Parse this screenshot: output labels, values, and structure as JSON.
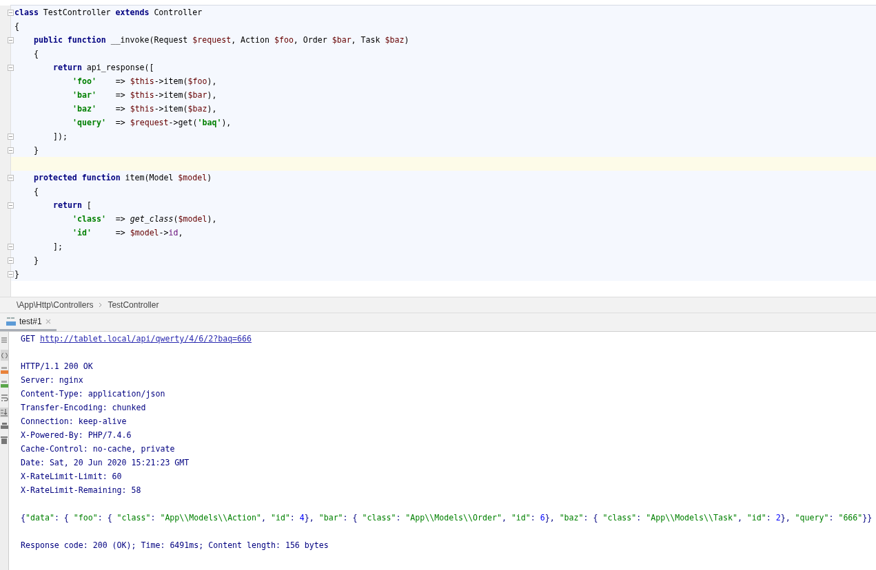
{
  "editor": {
    "lines": [
      {
        "fold": true,
        "current": false,
        "tokens": [
          {
            "t": "class",
            "kind": "kw"
          },
          {
            "t": "TestController",
            "kind": "plain"
          },
          {
            "t": "extends",
            "kind": "kw"
          },
          {
            "t": "Controller",
            "kind": "plain"
          }
        ]
      },
      {
        "fold": false,
        "current": false,
        "tokens": [
          {
            "t": "{",
            "kind": "plain"
          }
        ],
        "children": [
          {
            "fold": true,
            "current": false,
            "tokens": [
              {
                "t": "public function",
                "kind": "kw"
              },
              {
                "t": "__invoke(Request",
                "kind": "plain"
              },
              {
                "t": "$request",
                "kind": "var"
              },
              {
                "t": ", Action",
                "kind": "plain"
              },
              {
                "t": "$foo",
                "kind": "var"
              },
              {
                "t": ", Order",
                "kind": "plain"
              },
              {
                "t": "$bar",
                "kind": "var"
              },
              {
                "t": ", Task",
                "kind": "plain"
              },
              {
                "t": "$baz",
                "kind": "var"
              },
              {
                "t": ")",
                "kind": "plain"
              }
            ]
          },
          {
            "fold": false,
            "current": false,
            "tokens": [
              {
                "t": "{",
                "kind": "plain"
              }
            ],
            "children": [
              {
                "fold": true,
                "current": false,
                "tokens": [
                  {
                    "t": "return",
                    "kind": "kw"
                  },
                  {
                    "t": "api_response([",
                    "kind": "plain"
                  }
                ],
                "children": [
                  {
                    "fold": false,
                    "current": false,
                    "tokens": [
                      {
                        "t": "'foo'",
                        "kind": "str"
                      },
                      {
                        "t": "   =>",
                        "kind": "plain"
                      },
                      {
                        "t": "$this",
                        "kind": "var"
                      },
                      {
                        "t": "->item(",
                        "kind": "plain"
                      },
                      {
                        "t": "$foo",
                        "kind": "var"
                      },
                      {
                        "t": "),",
                        "kind": "plain"
                      }
                    ]
                  },
                  {
                    "fold": false,
                    "current": false,
                    "tokens": [
                      {
                        "t": "'bar'",
                        "kind": "str"
                      },
                      {
                        "t": "   =>",
                        "kind": "plain"
                      },
                      {
                        "t": "$this",
                        "kind": "var"
                      },
                      {
                        "t": "->item(",
                        "kind": "plain"
                      },
                      {
                        "t": "$bar",
                        "kind": "var"
                      },
                      {
                        "t": "),",
                        "kind": "plain"
                      }
                    ]
                  },
                  {
                    "fold": false,
                    "current": false,
                    "tokens": [
                      {
                        "t": "'baz'",
                        "kind": "str"
                      },
                      {
                        "t": "   =>",
                        "kind": "plain"
                      },
                      {
                        "t": "$this",
                        "kind": "var"
                      },
                      {
                        "t": "->item(",
                        "kind": "plain"
                      },
                      {
                        "t": "$baz",
                        "kind": "var"
                      },
                      {
                        "t": "),",
                        "kind": "plain"
                      }
                    ]
                  },
                  {
                    "fold": false,
                    "current": false,
                    "tokens": [
                      {
                        "t": "'query'",
                        "kind": "str"
                      },
                      {
                        "t": " =>",
                        "kind": "plain"
                      },
                      {
                        "t": "$request",
                        "kind": "var"
                      },
                      {
                        "t": "->get(",
                        "kind": "plain"
                      },
                      {
                        "t": "'baq'",
                        "kind": "str"
                      },
                      {
                        "t": "),",
                        "kind": "plain"
                      }
                    ]
                  }
                ]
              },
              {
                "fold": true,
                "current": false,
                "tokens": [
                  {
                    "t": "]);",
                    "kind": "plain"
                  }
                ]
              }
            ]
          },
          {
            "fold": true,
            "current": false,
            "tokens": [
              {
                "t": "}",
                "kind": "plain"
              }
            ]
          },
          {
            "fold": false,
            "current": true
          },
          {
            "fold": true,
            "current": false,
            "tokens": [
              {
                "t": "protected function",
                "kind": "kw"
              },
              {
                "t": "item(Model",
                "kind": "plain"
              },
              {
                "t": "$model",
                "kind": "var"
              },
              {
                "t": ")",
                "kind": "plain"
              }
            ]
          },
          {
            "fold": false,
            "current": false,
            "tokens": [
              {
                "t": "{",
                "kind": "plain"
              }
            ],
            "children": [
              {
                "fold": true,
                "current": false,
                "tokens": [
                  {
                    "t": "return",
                    "kind": "kw"
                  },
                  {
                    "t": "[",
                    "kind": "plain"
                  }
                ],
                "children": [
                  {
                    "fold": false,
                    "current": false,
                    "tokens": [
                      {
                        "t": "'class'",
                        "kind": "str"
                      },
                      {
                        "t": " =>",
                        "kind": "plain"
                      },
                      {
                        "t": "get_class",
                        "kind": "fn"
                      },
                      {
                        "t": "(",
                        "kind": "plain"
                      },
                      {
                        "t": "$model",
                        "kind": "var"
                      },
                      {
                        "t": "),",
                        "kind": "plain"
                      }
                    ]
                  },
                  {
                    "fold": false,
                    "current": false,
                    "tokens": [
                      {
                        "t": "'id'",
                        "kind": "str"
                      },
                      {
                        "t": "    =>",
                        "kind": "plain"
                      },
                      {
                        "t": "$model",
                        "kind": "var"
                      },
                      {
                        "t": "->",
                        "kind": "plain"
                      },
                      {
                        "t": "id",
                        "kind": "prop"
                      },
                      {
                        "t": ",",
                        "kind": "plain"
                      }
                    ]
                  }
                ]
              },
              {
                "fold": true,
                "current": false,
                "tokens": [
                  {
                    "t": "];",
                    "kind": "plain"
                  }
                ]
              }
            ]
          },
          {
            "fold": true,
            "current": false,
            "tokens": [
              {
                "t": "}",
                "kind": "plain"
              }
            ]
          }
        ]
      },
      {
        "fold": true,
        "current": false,
        "tokens": [
          {
            "t": "}",
            "kind": "plain"
          }
        ]
      }
    ]
  },
  "breadcrumb": [
    "\\App\\Http\\Controllers",
    "TestController"
  ],
  "tabs": [
    {
      "label": "test#1",
      "selected": true
    }
  ],
  "output": {
    "sections": [
      [
        {
          "kind": "request",
          "method": "GET",
          "url": "http://tablet.local/api/qwerty/4/6/2?baq=666"
        }
      ],
      [
        {
          "kind": "text",
          "text": "HTTP/1.1 200 OK"
        },
        {
          "kind": "text",
          "text": "Server: nginx"
        },
        {
          "kind": "text",
          "text": "Content-Type: application/json"
        },
        {
          "kind": "text",
          "text": "Transfer-Encoding: chunked"
        },
        {
          "kind": "text",
          "text": "Connection: keep-alive"
        },
        {
          "kind": "text",
          "text": "X-Powered-By: PHP/7.4.6"
        },
        {
          "kind": "text",
          "text": "Cache-Control: no-cache, private"
        },
        {
          "kind": "text",
          "text": "Date: Sat, 20 Jun 2020 15:21:23 GMT"
        },
        {
          "kind": "text",
          "text": "X-RateLimit-Limit: 60"
        },
        {
          "kind": "text",
          "text": "X-RateLimit-Remaining: 58"
        }
      ],
      [
        {
          "kind": "json",
          "tokens": [
            {
              "t": "{",
              "kind": "plain"
            },
            {
              "t": "\"data\"",
              "kind": "str"
            },
            {
              "t": ": {",
              "kind": "plain"
            },
            {
              "t": "\"foo\"",
              "kind": "str"
            },
            {
              "t": ": {",
              "kind": "plain"
            },
            {
              "t": "\"class\"",
              "kind": "str"
            },
            {
              "t": ":",
              "kind": "plain"
            },
            {
              "t": "\"App\\\\Models\\\\Action\"",
              "kind": "str"
            },
            {
              "t": ",",
              "kind": "plain"
            },
            {
              "t": "\"id\"",
              "kind": "str"
            },
            {
              "t": ":",
              "kind": "plain"
            },
            {
              "t": "4",
              "kind": "num"
            },
            {
              "t": "},",
              "kind": "plain"
            },
            {
              "t": "\"bar\"",
              "kind": "str"
            },
            {
              "t": ": {",
              "kind": "plain"
            },
            {
              "t": "\"class\"",
              "kind": "str"
            },
            {
              "t": ":",
              "kind": "plain"
            },
            {
              "t": "\"App\\\\Models\\\\Order\"",
              "kind": "str"
            },
            {
              "t": ",",
              "kind": "plain"
            },
            {
              "t": "\"id\"",
              "kind": "str"
            },
            {
              "t": ":",
              "kind": "plain"
            },
            {
              "t": "6",
              "kind": "num"
            },
            {
              "t": "},",
              "kind": "plain"
            },
            {
              "t": "\"baz\"",
              "kind": "str"
            },
            {
              "t": ": {",
              "kind": "plain"
            },
            {
              "t": "\"class\"",
              "kind": "str"
            },
            {
              "t": ":",
              "kind": "plain"
            },
            {
              "t": "\"App\\\\Models\\\\Task\"",
              "kind": "str"
            },
            {
              "t": ",",
              "kind": "plain"
            },
            {
              "t": "\"id\"",
              "kind": "str"
            },
            {
              "t": ":",
              "kind": "plain"
            },
            {
              "t": "2",
              "kind": "num"
            },
            {
              "t": "},",
              "kind": "plain"
            },
            {
              "t": "\"query\"",
              "kind": "str"
            },
            {
              "t": ":",
              "kind": "plain"
            },
            {
              "t": "\"666\"",
              "kind": "str"
            },
            {
              "t": "}}",
              "kind": "plain"
            }
          ]
        }
      ],
      [
        {
          "kind": "text",
          "text": "Response code: 200 (OK); Time: 6491ms; Content length: 156 bytes"
        }
      ]
    ]
  }
}
